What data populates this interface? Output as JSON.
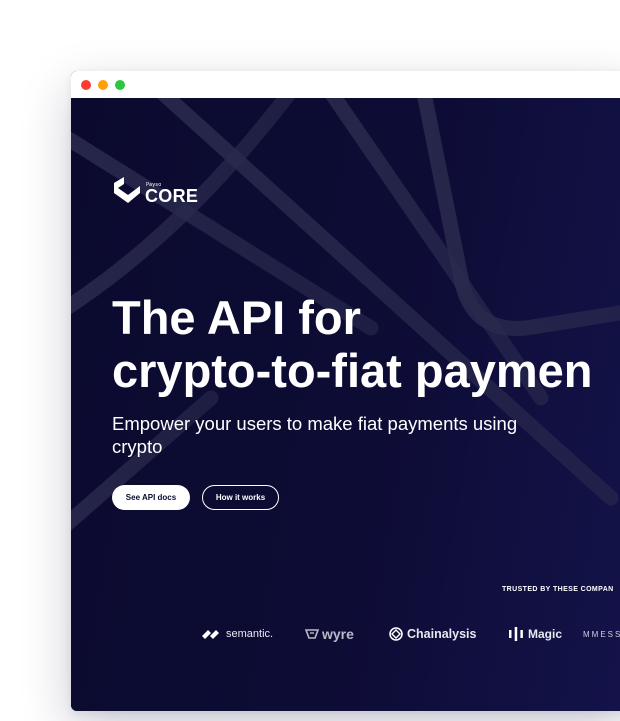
{
  "window": {
    "traffic_lights": [
      "#ff3b30",
      "#ff9f0a",
      "#28c840"
    ]
  },
  "brand": {
    "small_text": "Paysо",
    "name": "CORE",
    "icon": "core-logo-icon"
  },
  "hero": {
    "headline_line1": "The API for",
    "headline_line2": "crypto-to-fiat paymen",
    "subheadline": "Empower your users to make fiat payments using crypto",
    "primary_button": "See API docs",
    "secondary_button": "How it works"
  },
  "trusted": {
    "label": "TRUSTED BY THESE COMPAN",
    "partners": [
      {
        "name": "semantic.",
        "icon": "semantic-logo-icon"
      },
      {
        "name": "wyre",
        "icon": "wyre-logo-icon"
      },
      {
        "name": "Chainalysis",
        "icon": "chainalysis-logo-icon"
      },
      {
        "name": "Magic",
        "icon": "magic-logo-icon"
      },
      {
        "name": "MMESS",
        "icon": "messari-logo-icon"
      }
    ]
  },
  "colors": {
    "background": "#0b0a2e",
    "text": "#ffffff",
    "accent_line": "#3a3a5c"
  }
}
